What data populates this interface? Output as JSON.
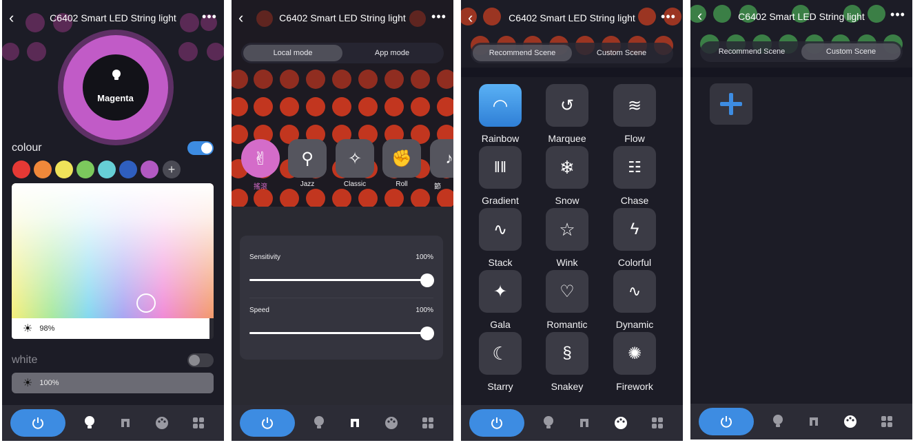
{
  "app": {
    "title": "C6402 Smart LED String light",
    "back_icon": "chevron-left-icon",
    "more_icon": "more-icon"
  },
  "tabbar": {
    "items": [
      "power-icon",
      "bulb-icon",
      "music-icon",
      "palette-icon",
      "grid-icon"
    ]
  },
  "screen1": {
    "selected_color_name": "Magenta",
    "colour_label": "colour",
    "colour_toggle_on": true,
    "swatches": [
      "#e53935",
      "#f0883a",
      "#efe35a",
      "#7cc95d",
      "#66cfd6",
      "#2f5fbf",
      "#b259c2"
    ],
    "add_swatch_label": "+",
    "colour_brightness": "98%",
    "white_label": "white",
    "white_toggle_on": false,
    "white_brightness": "100%",
    "accent_color": "#c15bc7"
  },
  "screen2": {
    "segments": [
      "Local mode",
      "App mode"
    ],
    "active_segment": "Local mode",
    "genres": [
      {
        "label": "搖滾",
        "icon": "rock-hand-icon",
        "active": true
      },
      {
        "label": "Jazz",
        "icon": "jazz-dancer-icon",
        "active": false
      },
      {
        "label": "Classic",
        "icon": "ballet-dancer-icon",
        "active": false
      },
      {
        "label": "Roll",
        "icon": "muscle-arm-icon",
        "active": false
      },
      {
        "label": "節",
        "icon": "note-icon",
        "active": false
      }
    ],
    "sensitivity": {
      "label": "Sensitivity",
      "value": "100%",
      "level": 1.0
    },
    "speed": {
      "label": "Speed",
      "value": "100%",
      "level": 1.0
    }
  },
  "screen3": {
    "segments": [
      "Recommend Scene",
      "Custom Scene"
    ],
    "active_segment": "Recommend Scene",
    "scenes": [
      {
        "label": "Rainbow",
        "icon": "rainbow-icon",
        "selected": true
      },
      {
        "label": "Marquee",
        "icon": "marquee-icon",
        "selected": false
      },
      {
        "label": "Flow",
        "icon": "flow-icon",
        "selected": false
      },
      {
        "label": "Gradient",
        "icon": "gradient-icon",
        "selected": false
      },
      {
        "label": "Snow",
        "icon": "snowflake-icon",
        "selected": false
      },
      {
        "label": "Chase",
        "icon": "chase-icon",
        "selected": false
      },
      {
        "label": "Stack",
        "icon": "stack-icon",
        "selected": false
      },
      {
        "label": "Wink",
        "icon": "wink-star-icon",
        "selected": false
      },
      {
        "label": "Colorful",
        "icon": "lightning-icon",
        "selected": false
      },
      {
        "label": "Gala",
        "icon": "party-popper-icon",
        "selected": false
      },
      {
        "label": "Romantic",
        "icon": "hearts-icon",
        "selected": false
      },
      {
        "label": "Dynamic",
        "icon": "pulse-icon",
        "selected": false
      },
      {
        "label": "Starry",
        "icon": "moon-stars-icon",
        "selected": false
      },
      {
        "label": "Snakey",
        "icon": "snake-icon",
        "selected": false
      },
      {
        "label": "Firework",
        "icon": "firework-icon",
        "selected": false
      }
    ]
  },
  "screen4": {
    "segments": [
      "Recommend Scene",
      "Custom Scene"
    ],
    "active_segment": "Custom Scene",
    "add_icon": "plus-icon"
  }
}
